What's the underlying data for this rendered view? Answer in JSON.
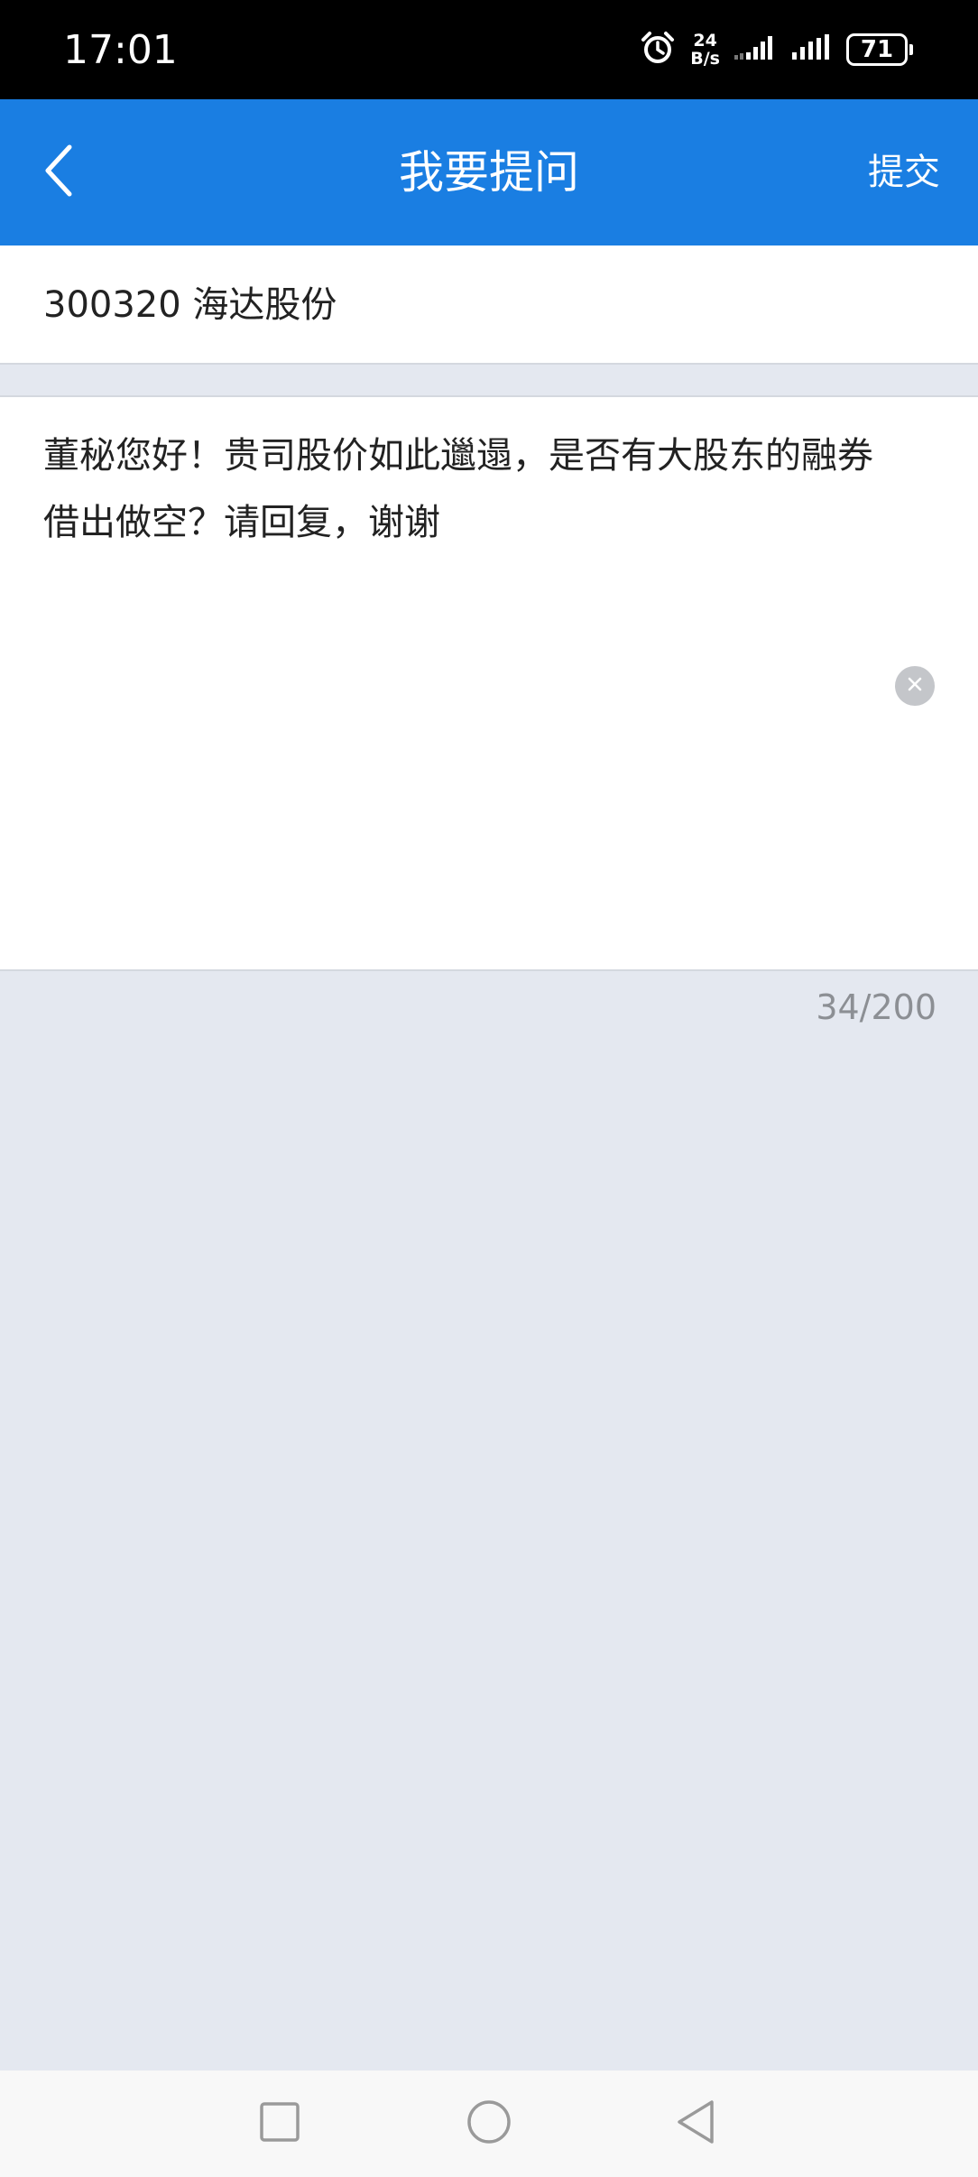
{
  "status_bar": {
    "time": "17:01",
    "net_speed_value": "24",
    "net_speed_unit": "B/s",
    "battery": "71",
    "icons": [
      "alarm-icon",
      "net-speed-icon",
      "signal-icon",
      "signal-icon",
      "battery-icon"
    ]
  },
  "header": {
    "title": "我要提问",
    "submit_label": "提交",
    "background": "#1a7ee2"
  },
  "stock": {
    "label": "300320 海达股份"
  },
  "question": {
    "text": "董秘您好！贵司股价如此邋遢，是否有大股东的融券借出做空？请回复，谢谢",
    "char_count": "34/200"
  },
  "nav_bar": {
    "icons": [
      "recents-square-icon",
      "home-circle-icon",
      "back-triangle-icon"
    ]
  }
}
